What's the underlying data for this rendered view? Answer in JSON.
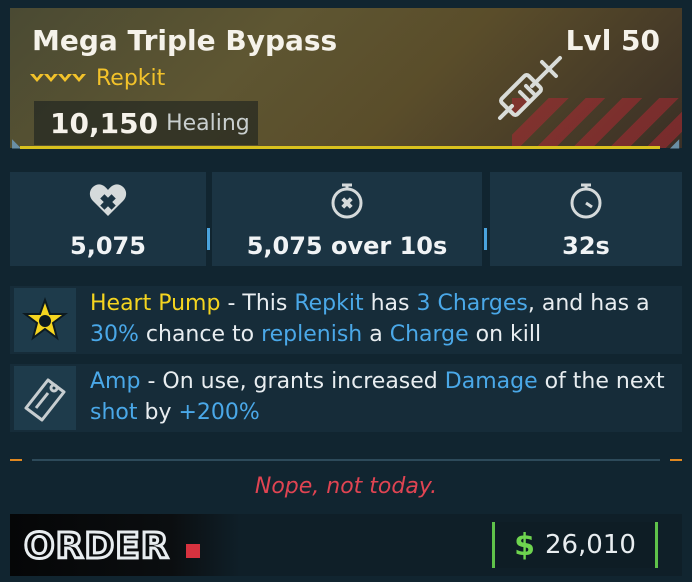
{
  "item": {
    "name": "Mega Triple Bypass",
    "level": "Lvl 50",
    "type": "Repkit",
    "main_stat_value": "10,150",
    "main_stat_label": "Healing",
    "rarity_color": "#f2c22a"
  },
  "stats": [
    {
      "icon": "heart-plus-icon",
      "value": "5,075"
    },
    {
      "icon": "stopwatch-heal-icon",
      "value": "5,075 over 10s"
    },
    {
      "icon": "stopwatch-icon",
      "value": "32s"
    }
  ],
  "perks": [
    {
      "icon": "star-burst-icon",
      "parts": [
        {
          "t": "Heart Pump",
          "c": "y"
        },
        {
          "t": " - This ",
          "c": ""
        },
        {
          "t": "Repkit",
          "c": "b"
        },
        {
          "t": " has ",
          "c": ""
        },
        {
          "t": "3 Charges",
          "c": "b"
        },
        {
          "t": ", and has a ",
          "c": ""
        },
        {
          "t": "30%",
          "c": "b"
        },
        {
          "t": " chance to ",
          "c": ""
        },
        {
          "t": "replenish",
          "c": "b"
        },
        {
          "t": " a ",
          "c": ""
        },
        {
          "t": "Charge",
          "c": "b"
        },
        {
          "t": " on kill",
          "c": ""
        }
      ]
    },
    {
      "icon": "amp-tag-icon",
      "parts": [
        {
          "t": "Amp",
          "c": "b"
        },
        {
          "t": " - On use, grants increased ",
          "c": ""
        },
        {
          "t": "Damage",
          "c": "b"
        },
        {
          "t": " of the next ",
          "c": ""
        },
        {
          "t": "shot",
          "c": "b"
        },
        {
          "t": " by ",
          "c": ""
        },
        {
          "t": "+200%",
          "c": "b"
        }
      ]
    }
  ],
  "flavor_text": "Nope, not today.",
  "manufacturer": "ORDER",
  "price": {
    "currency": "$",
    "amount": "26,010"
  },
  "colors": {
    "highlight_yellow": "#f5d51f",
    "highlight_blue": "#4aa8e8",
    "flavor_red": "#e04452",
    "price_green": "#6ed44f"
  }
}
